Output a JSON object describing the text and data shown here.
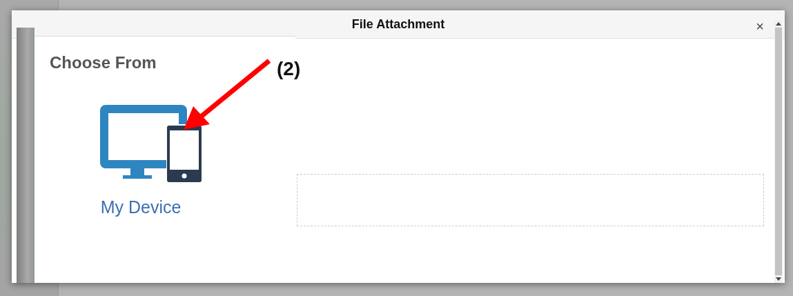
{
  "dialog": {
    "title": "File Attachment",
    "close": "×"
  },
  "choose_panel": {
    "heading": "Choose From",
    "options": [
      {
        "label": "My Device"
      }
    ]
  },
  "annotation": {
    "label": "(2)"
  }
}
